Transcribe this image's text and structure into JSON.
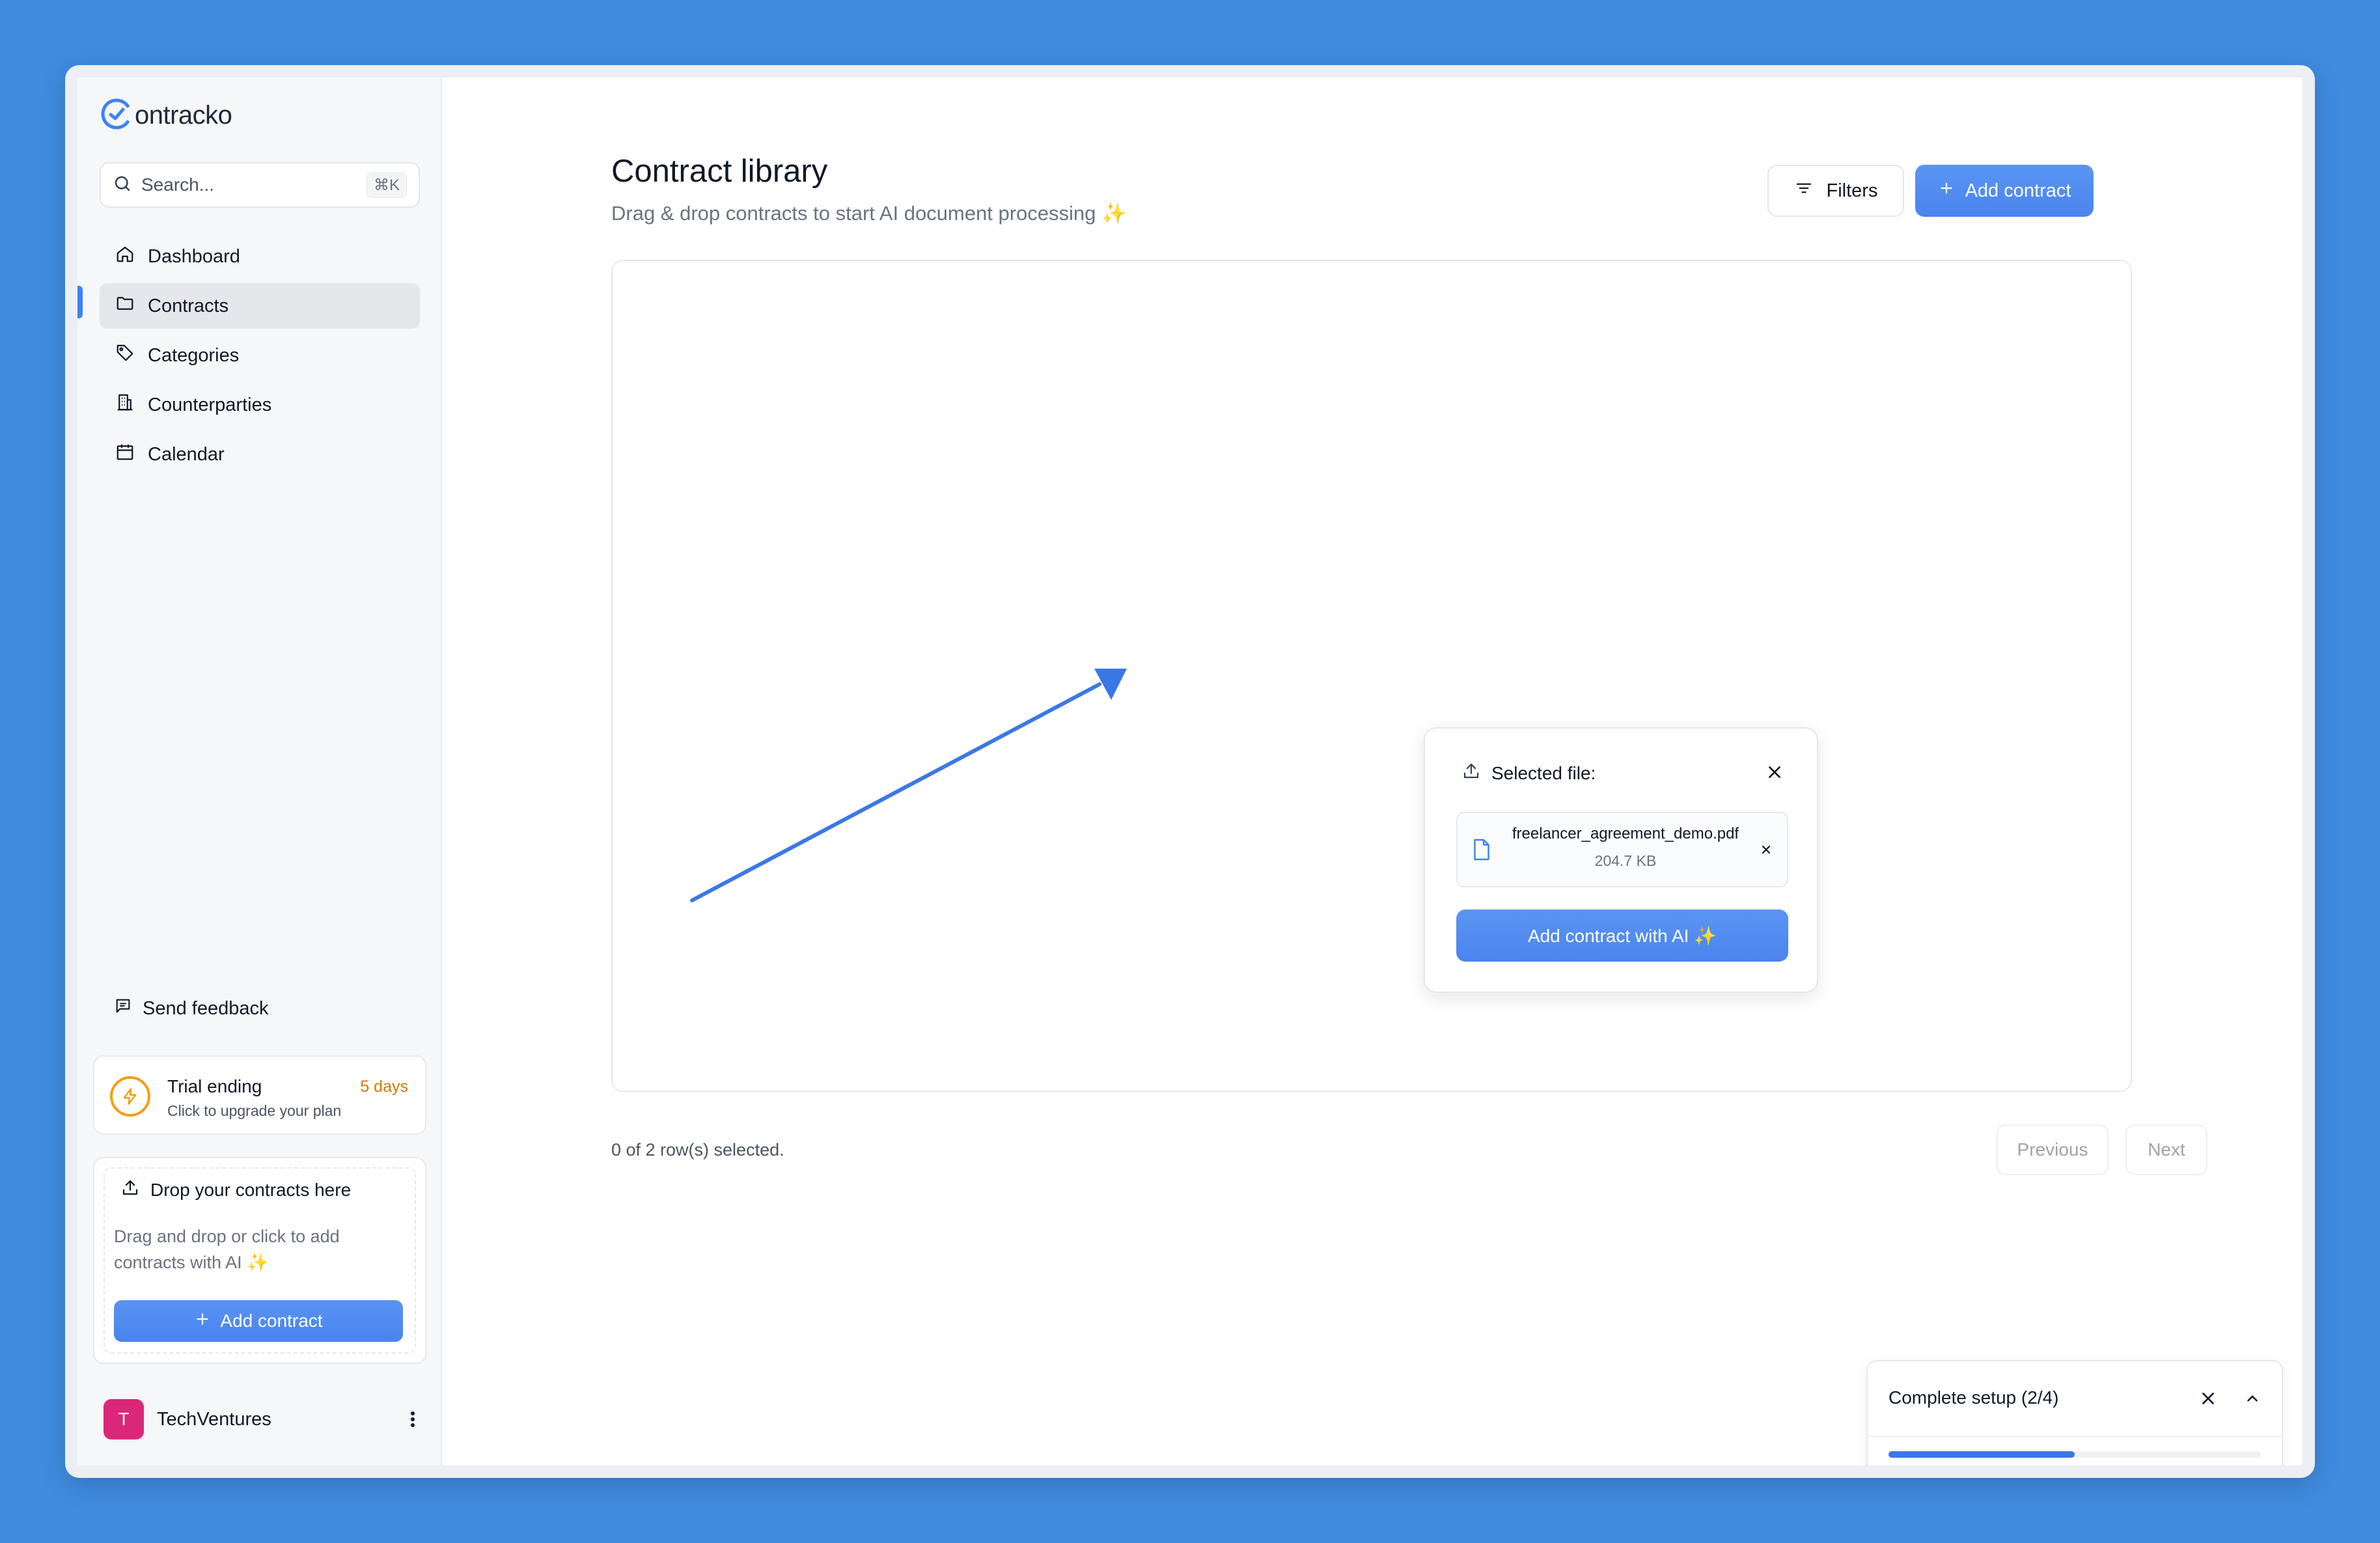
{
  "brand": {
    "name": "ontracko",
    "accent": "#3b82f6"
  },
  "search": {
    "placeholder": "Search...",
    "shortcut": "⌘K"
  },
  "sidebar": {
    "items": [
      {
        "label": "Dashboard",
        "icon": "home-icon"
      },
      {
        "label": "Contracts",
        "icon": "folder-icon",
        "active": true
      },
      {
        "label": "Categories",
        "icon": "tag-icon"
      },
      {
        "label": "Counterparties",
        "icon": "building-icon"
      },
      {
        "label": "Calendar",
        "icon": "calendar-icon"
      }
    ],
    "feedback_label": "Send feedback",
    "trial": {
      "title": "Trial ending",
      "subtitle": "Click to upgrade your plan",
      "days": "5 days"
    },
    "dropbox": {
      "title": "Drop your contracts here",
      "description": "Drag and drop or click to add contracts with AI ✨",
      "button_label": "Add contract"
    },
    "user": {
      "initial": "T",
      "name": "TechVentures"
    }
  },
  "main": {
    "title": "Contract library",
    "subtitle": "Drag & drop contracts to start AI document processing ✨",
    "filters_label": "Filters",
    "add_label": "Add contract",
    "popover": {
      "heading": "Selected file:",
      "file_name": "freelancer_agreement_demo.pdf",
      "file_size": "204.7 KB",
      "button_label": "Add contract with AI ✨"
    },
    "rows_selected": "0 of 2 row(s) selected.",
    "pagination": {
      "previous": "Previous",
      "next": "Next"
    }
  },
  "setup": {
    "title": "Complete setup (2/4)",
    "progress": 0.5
  }
}
